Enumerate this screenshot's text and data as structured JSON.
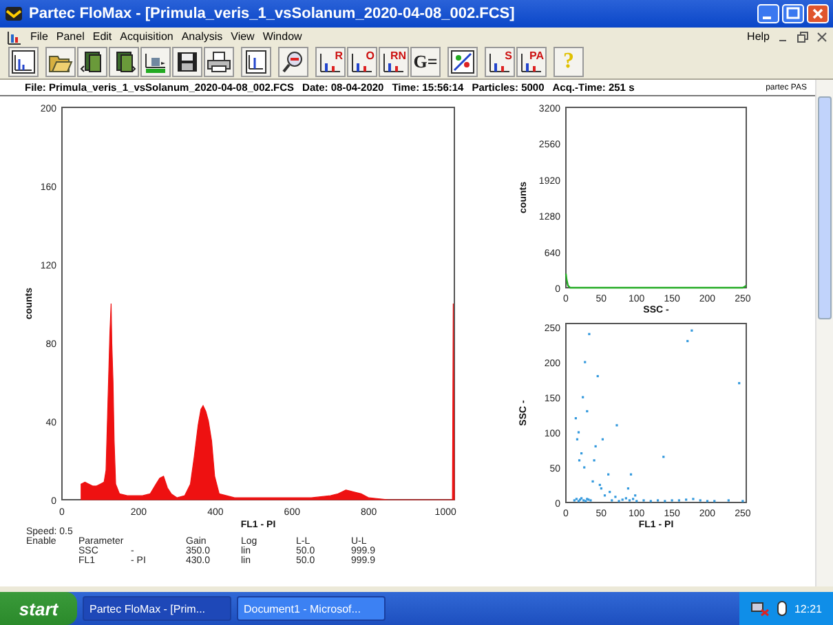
{
  "window": {
    "title": "Partec FloMax - [Primula_veris_1_vsSolanum_2020-04-08_002.FCS]"
  },
  "menu": {
    "items": [
      "File",
      "Panel",
      "Edit",
      "Acquisition",
      "Analysis",
      "View",
      "Window"
    ],
    "right": "Help"
  },
  "toolbar": [
    [
      {
        "kind": "histogram"
      }
    ],
    [
      {
        "kind": "open"
      },
      {
        "kind": "previous"
      },
      {
        "kind": "next"
      },
      {
        "kind": "acquire"
      },
      {
        "kind": "save"
      },
      {
        "kind": "print"
      }
    ],
    [
      {
        "kind": "preview"
      }
    ],
    [
      {
        "kind": "magnifier"
      }
    ],
    [
      {
        "kind": "letter",
        "label": "R"
      },
      {
        "kind": "letter",
        "label": "O"
      },
      {
        "kind": "letter",
        "label": "RN"
      },
      {
        "kind": "text",
        "label": "G="
      }
    ],
    [
      {
        "kind": "gate"
      }
    ],
    [
      {
        "kind": "letter",
        "label": "S"
      },
      {
        "kind": "letter",
        "label": "PA"
      }
    ],
    [
      {
        "kind": "text",
        "label": "?"
      }
    ]
  ],
  "info": {
    "fields": [
      "File: Primula_veris_1_vsSolanum_2020-04-08_002.FCS",
      "Date: 08-04-2020",
      "Time: 15:56:14",
      "Particles: 5000",
      "Acq.-Time: 251 s"
    ],
    "brand": "partec PAS"
  },
  "charts": [
    {
      "chart_data": {
        "type": "area",
        "xlabel": "FL1 - PI",
        "ylabel": "counts",
        "xlim": [
          0,
          1023
        ],
        "ylim": [
          0,
          200
        ],
        "xticks": [
          0,
          200,
          400,
          600,
          800,
          1000
        ],
        "yticks": [
          0,
          40,
          80,
          120,
          160,
          200
        ],
        "x": [
          50,
          60,
          70,
          80,
          90,
          100,
          110,
          115,
          120,
          125,
          128,
          130,
          133,
          136,
          140,
          150,
          170,
          190,
          210,
          230,
          245,
          255,
          265,
          275,
          285,
          300,
          320,
          335,
          345,
          355,
          362,
          368,
          375,
          382,
          390,
          398,
          410,
          450,
          500,
          550,
          600,
          650,
          700,
          720,
          740,
          760,
          780,
          800,
          850,
          900,
          1000,
          1018,
          1020,
          1023
        ],
        "series": [
          {
            "color": "#ee1111",
            "values": [
              8,
              9,
              8,
              7,
              7,
              8,
              9,
              15,
              50,
              85,
              100,
              80,
              60,
              30,
              8,
              3,
              2,
              2,
              2,
              3,
              8,
              11,
              12,
              6,
              3,
              1,
              2,
              8,
              22,
              38,
              46,
              48,
              45,
              40,
              30,
              12,
              3,
              1,
              1,
              1,
              1,
              1,
              2,
              3,
              5,
              4,
              3,
              1,
              0,
              0,
              0,
              0,
              100,
              0
            ]
          }
        ]
      }
    },
    {
      "chart_data": {
        "type": "line",
        "xlabel": "SSC -",
        "ylabel": "counts",
        "xlim": [
          0,
          255
        ],
        "ylim": [
          0,
          3200
        ],
        "xticks": [
          0,
          50,
          100,
          150,
          200,
          250
        ],
        "yticks": [
          0,
          640,
          1280,
          1920,
          2560,
          3200
        ],
        "x": [
          0,
          1,
          3,
          6,
          10,
          50,
          100,
          150,
          200,
          250,
          253,
          255
        ],
        "series": [
          {
            "color": "#22aa22",
            "values": [
              250,
              150,
              40,
              0,
              0,
              0,
              0,
              0,
              0,
              0,
              20,
              40
            ]
          }
        ]
      }
    },
    {
      "chart_data": {
        "type": "scatter",
        "xlabel": "FL1 - PI",
        "ylabel": "SSC -",
        "xlim": [
          0,
          255
        ],
        "ylim": [
          0,
          255
        ],
        "xticks": [
          0,
          50,
          100,
          150,
          200,
          250
        ],
        "yticks": [
          0,
          50,
          100,
          150,
          200,
          250
        ],
        "x": [
          12,
          15,
          18,
          20,
          22,
          25,
          28,
          30,
          32,
          35,
          14,
          16,
          19,
          24,
          27,
          33,
          38,
          42,
          45,
          50,
          55,
          60,
          65,
          70,
          75,
          80,
          85,
          90,
          95,
          100,
          110,
          120,
          130,
          140,
          150,
          160,
          170,
          180,
          190,
          200,
          210,
          230,
          250,
          18,
          22,
          26,
          30,
          40,
          48,
          52,
          62,
          72,
          88,
          92,
          98,
          172,
          178,
          138,
          245
        ],
        "series": [
          {
            "color": "#3399dd",
            "values": [
              3,
              5,
              2,
              4,
              6,
              3,
              2,
              5,
              4,
              3,
              120,
              90,
              60,
              150,
              200,
              240,
              30,
              80,
              180,
              20,
              10,
              40,
              3,
              8,
              2,
              4,
              6,
              3,
              5,
              2,
              3,
              2,
              3,
              2,
              3,
              3,
              4,
              5,
              3,
              2,
              2,
              3,
              2,
              100,
              70,
              50,
              130,
              60,
              25,
              90,
              15,
              110,
              20,
              40,
              10,
              230,
              245,
              65,
              170
            ]
          }
        ]
      }
    }
  ],
  "parameters": {
    "speed": "Speed: 0.5",
    "headers": [
      "Enable",
      "Parameter",
      "Gain",
      "Log",
      "L-L",
      "U-L"
    ],
    "rows": [
      [
        "SSC",
        "-",
        "350.0",
        "lin",
        "50.0",
        "999.9"
      ],
      [
        "FL1",
        "- PI",
        "430.0",
        "lin",
        "50.0",
        "999.9"
      ]
    ]
  },
  "taskbar": {
    "start": "start",
    "tasks": [
      {
        "label": "Partec FloMax - [Prim...",
        "selected": true
      },
      {
        "label": "Document1 - Microsof...",
        "selected": false
      }
    ],
    "clock": "12:21"
  }
}
